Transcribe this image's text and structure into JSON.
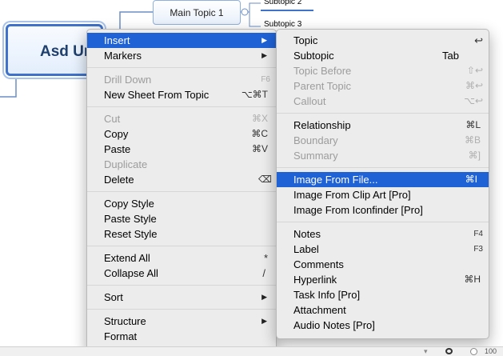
{
  "canvas": {
    "central_topic": "Asd Ur",
    "main_topic": "Main Topic 1",
    "subtopic_2": "Subtopic 2",
    "subtopic_3": "Subtopic 3"
  },
  "context_menu": {
    "insert": "Insert",
    "markers": "Markers",
    "drill_down": "Drill Down",
    "drill_down_shortcut": "F6",
    "new_sheet": "New Sheet From Topic",
    "new_sheet_shortcut": "⌥⌘T",
    "cut": "Cut",
    "cut_shortcut": "⌘X",
    "copy": "Copy",
    "copy_shortcut": "⌘C",
    "paste": "Paste",
    "paste_shortcut": "⌘V",
    "duplicate": "Duplicate",
    "delete": "Delete",
    "delete_shortcut": "⌫",
    "copy_style": "Copy Style",
    "paste_style": "Paste Style",
    "reset_style": "Reset Style",
    "extend_all": "Extend All",
    "extend_all_shortcut": "*",
    "collapse_all": "Collapse All",
    "collapse_all_shortcut": "/",
    "sort": "Sort",
    "structure": "Structure",
    "format": "Format"
  },
  "insert_submenu": {
    "topic": "Topic",
    "topic_shortcut": "↩",
    "subtopic": "Subtopic",
    "subtopic_shortcut": "Tab",
    "topic_before": "Topic Before",
    "topic_before_shortcut": "⇧↩",
    "parent_topic": "Parent Topic",
    "parent_topic_shortcut": "⌘↩",
    "callout": "Callout",
    "callout_shortcut": "⌥↩",
    "relationship": "Relationship",
    "relationship_shortcut": "⌘L",
    "boundary": "Boundary",
    "boundary_shortcut": "⌘B",
    "summary": "Summary",
    "summary_shortcut": "⌘]",
    "image_from_file": "Image From File...",
    "image_from_file_shortcut": "⌘I",
    "image_from_clip_art": "Image From Clip Art [Pro]",
    "image_from_iconfinder": "Image From Iconfinder [Pro]",
    "notes": "Notes",
    "notes_shortcut": "F4",
    "label": "Label",
    "label_shortcut": "F3",
    "comments": "Comments",
    "hyperlink": "Hyperlink",
    "hyperlink_shortcut": "⌘H",
    "task_info": "Task Info [Pro]",
    "attachment": "Attachment",
    "audio_notes": "Audio Notes [Pro]"
  },
  "status_bar": {
    "zoom_text": "100"
  },
  "colors": {
    "highlight": "#1f62d6",
    "topic_border": "#3f72c8"
  }
}
